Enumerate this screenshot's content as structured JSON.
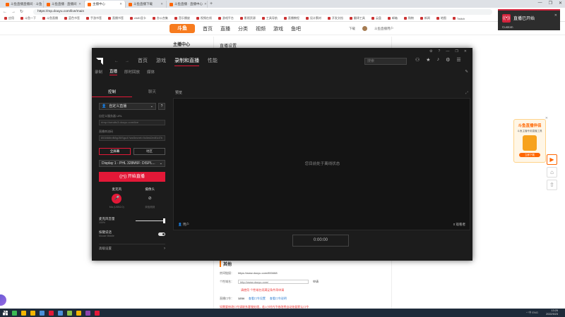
{
  "browser": {
    "tabs": [
      {
        "label": "斗鱼直播直播间 · 斗鱼",
        "active": false
      },
      {
        "label": "斗鱼直播 · 直播间",
        "active": false
      },
      {
        "label": "主播中心",
        "active": true
      },
      {
        "label": "斗鱼直播下载",
        "active": false
      },
      {
        "label": "斗鱼直播 · 直播中心",
        "active": false
      }
    ],
    "new_tab": "+",
    "window_controls": [
      "—",
      "❐",
      "✕"
    ],
    "nav": [
      "←",
      "→",
      "↻"
    ],
    "url": "https://mp.douyu.com/live/main",
    "bookmarks": [
      "应用",
      "斗鱼一下",
      "斗鱼直播",
      "蓝色书签",
      "手游书签",
      "直播书签",
      "AMD显卡",
      "办公合集",
      "音乐播放",
      "视频在线",
      "游戏平台",
      "影视资源",
      "工具导航",
      "直播教程",
      "设计素材",
      "开发文档",
      "翻译工具",
      "云盘",
      "邮箱",
      "购物",
      "新闻",
      "地图",
      "Twitch"
    ]
  },
  "site": {
    "logo": "斗鱼",
    "nav": [
      "首页",
      "直播",
      "分类",
      "视频",
      "游戏",
      "鱼吧"
    ],
    "right": [
      "下载",
      "斗鱼直播用户"
    ],
    "left_title": "主播中心",
    "content_title": "直播设置",
    "other": {
      "heading": "其他",
      "room_label": "房间链接：",
      "room_value": "https://www.douyu.com/853468",
      "custom_label": "个性域名：",
      "custom_value": "http://www.douyu.com/",
      "custom_btn": "申请",
      "custom_warn": "请使用 个性域名须满足条件再申请",
      "code_label": "直播口令：",
      "code_value": "1234",
      "code_link1": "查看口令设置",
      "code_link2": "查看口令说明",
      "bottom_warn": "如需要修改口令请联系客服处理，若1小时内不修改将自动恢复默认口令"
    }
  },
  "notification": {
    "title": "直播已开始",
    "sub": "Custom",
    "close": "✕"
  },
  "ad": {
    "title": "斗鱼直播伴侣",
    "sub": "斗鱼主播专用直播工具",
    "btn": "立即下载",
    "close": "✕"
  },
  "side_buttons": [
    "▶",
    "⌂",
    "⇧"
  ],
  "amd": {
    "window_controls": [
      "⚙",
      "?",
      "—",
      "❐",
      "✕"
    ],
    "arrows": [
      "←",
      "→"
    ],
    "menu": [
      {
        "label": "首页",
        "active": false
      },
      {
        "label": "游戏",
        "active": false
      },
      {
        "label": "录制和直播",
        "active": true
      },
      {
        "label": "性能",
        "active": false
      }
    ],
    "search_placeholder": "搜索",
    "top_icons": [
      "⚇",
      "★",
      "♪",
      "⚙",
      "☰"
    ],
    "subtabs": [
      {
        "label": "录制",
        "active": false
      },
      {
        "label": "直播",
        "active": true
      },
      {
        "label": "即时回放",
        "active": false
      },
      {
        "label": "媒体",
        "active": false
      }
    ],
    "sub_gear": "✎",
    "panel": {
      "tabs": [
        {
          "label": "控制",
          "active": true
        },
        {
          "label": "聊天",
          "active": false
        }
      ],
      "service": "自定义直播",
      "help": "?",
      "server_label": "自定义服务器 URL",
      "server_value": "rtmp://sendtc3.douyu.com/live",
      "key_label": "直播串流码",
      "key_value": "853468rvB8gJ5ISgu4?wsSecret=9c0ed2e4f1d7b",
      "btn_all": "全屏幕",
      "btn_region": "地区",
      "display": "Display 1 - PHL 328M6F: DISPL...",
      "go_live": "开始直播",
      "mic_label": "麦克风",
      "mic_status": "Mic (USB2.0)",
      "cam_label": "摄像头",
      "cam_status": "未检测到",
      "vol_label": "麦克风音量",
      "vol_sub": "100%",
      "vol_value": 1.0,
      "mute_label": "按键说话",
      "mute_sub": "Mouse Middle",
      "more": "高级设置",
      "more_arrow": "›"
    },
    "preview": {
      "title": "预览",
      "icon": "⤢",
      "message": "您目前处于离线状态",
      "user": "用户",
      "viewers": "0 观看者",
      "timer": "0:00:00"
    }
  },
  "taskbar": {
    "time": "13:25",
    "date": "2022/5/23",
    "tray": "^ 中 ENG",
    "icon_colors": [
      "#ffffff",
      "#3cba54",
      "#f4b400",
      "#f4b400",
      "#4a90d9",
      "#e31837",
      "#4a90d9",
      "#8bc34a",
      "#f4b400",
      "#8e44ad",
      "#e31837"
    ]
  }
}
